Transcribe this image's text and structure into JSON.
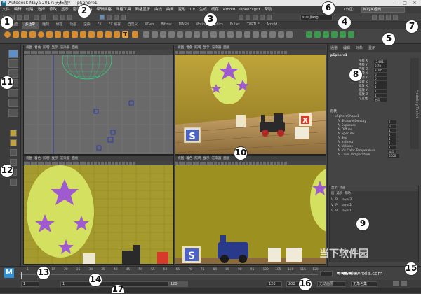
{
  "window": {
    "logo": "M",
    "title": "Autodesk Maya 2017: 无标题*",
    "subtitle": "pSphere1",
    "min": "–",
    "max": "□",
    "close": "✕"
  },
  "menus": [
    "文件",
    "编辑",
    "创建",
    "选择",
    "修改",
    "显示",
    "窗口",
    "网格",
    "编辑网格",
    "网格工具",
    "网格显示",
    "曲线",
    "曲面",
    "变形",
    "UV",
    "生成",
    "缓存",
    "Arnold",
    "OpenFlight",
    "帮助"
  ],
  "workspace": {
    "label": "工作区:",
    "value": "Maya 经典"
  },
  "user": "sue jiang",
  "shelf_tabs": [
    "曲线/曲面",
    "多边形",
    "雕刻",
    "绑定",
    "动画",
    "渲染",
    "FX",
    "FX 缓存",
    "自定义",
    "XGen",
    "Bifrost",
    "MASH",
    "Motion Graphics",
    "Bullet",
    "TURTLE",
    "Arnold"
  ],
  "shelf_active": 1,
  "viewport_menu": [
    "视图",
    "着色",
    "照明",
    "显示",
    "渲染器",
    "面板"
  ],
  "attr_panel": {
    "tabs": [
      "通道",
      "编辑",
      "对象",
      "显示"
    ],
    "object": "pSphere1",
    "fields": [
      {
        "label": "平移 X",
        "value": "-3.691"
      },
      {
        "label": "平移 Y",
        "value": "0.78"
      },
      {
        "label": "平移 Z",
        "value": "3.105"
      },
      {
        "label": "旋转 X",
        "value": "0"
      },
      {
        "label": "旋转 Y",
        "value": "0"
      },
      {
        "label": "旋转 Z",
        "value": "0"
      },
      {
        "label": "缩放 X",
        "value": "1"
      },
      {
        "label": "缩放 Y",
        "value": "1"
      },
      {
        "label": "缩放 Z",
        "value": "1"
      },
      {
        "label": "可见性",
        "value": "启用"
      }
    ],
    "shapes_label": "形状",
    "shape_name": "pSphereShape1",
    "shape_fields": [
      {
        "label": "Ai Shadow Density",
        "value": "1"
      },
      {
        "label": "Ai Exposure",
        "value": "0"
      },
      {
        "label": "Ai Diffuse",
        "value": "1"
      },
      {
        "label": "Ai Specular",
        "value": "1"
      },
      {
        "label": "Ai Sss",
        "value": "1"
      },
      {
        "label": "Ai Indirect",
        "value": "1"
      },
      {
        "label": "Ai Volume",
        "value": "1"
      },
      {
        "label": "Ai Vis Color Temperature",
        "value": "禁用"
      },
      {
        "label": "Ai Color Temperature",
        "value": "6500"
      }
    ]
  },
  "layer_panel": {
    "tabs": [
      "显示",
      "动画"
    ],
    "menu": [
      "层",
      "选项",
      "帮助"
    ],
    "layers": [
      {
        "v": "V",
        "p": "P",
        "name": "layer3"
      },
      {
        "v": "V",
        "p": "P",
        "name": "layer2"
      },
      {
        "v": "V",
        "p": "P",
        "name": "layer1"
      }
    ]
  },
  "side_tab": "Modeling Toolkit",
  "timeline": {
    "ticks": [
      "5",
      "10",
      "15",
      "20",
      "25",
      "30",
      "35",
      "40",
      "45",
      "50",
      "55",
      "60",
      "65",
      "70",
      "75",
      "80",
      "85",
      "90",
      "95",
      "100",
      "105",
      "110",
      "115",
      "120"
    ],
    "current_frame": "1"
  },
  "range": {
    "start": "1",
    "start_inner": "1",
    "end_inner": "120",
    "end": "120",
    "end2": "200",
    "anim_layer": "无动画层",
    "char_set": "无角色集"
  },
  "toys": {
    "block1": "S",
    "block2": "X"
  },
  "watermark": {
    "main": "当下软件园",
    "url": "www.downxia.com"
  },
  "callouts": [
    "1",
    "2",
    "3",
    "4",
    "5",
    "6",
    "7",
    "8",
    "9",
    "10",
    "11",
    "12",
    "13",
    "14",
    "15",
    "16",
    "17"
  ],
  "colors": {
    "accent": "#5e8fc7",
    "titlebar": "#e8e8e8"
  }
}
